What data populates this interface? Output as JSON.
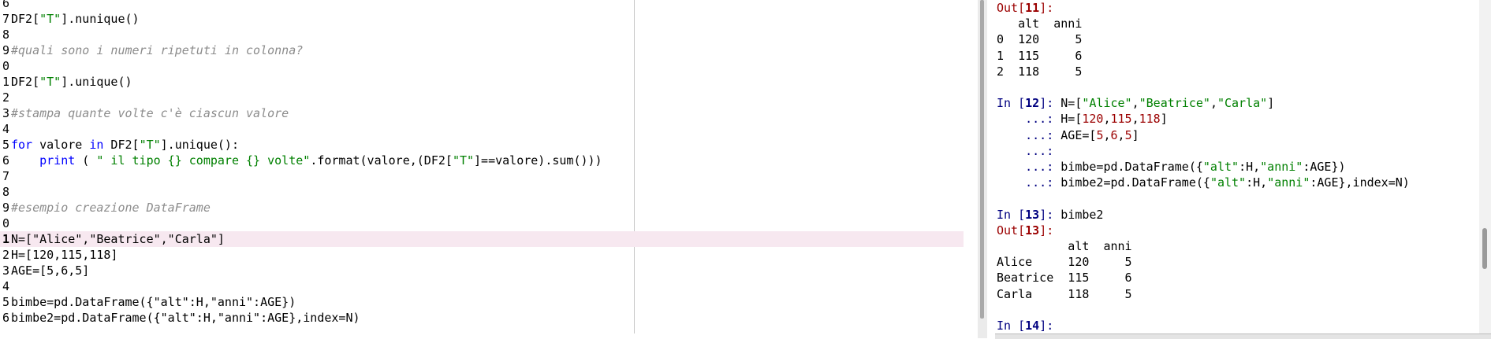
{
  "editor": {
    "lines": [
      {
        "ln": "6",
        "parts": []
      },
      {
        "ln": "7",
        "parts": [
          {
            "t": "DF2["
          },
          {
            "t": "\"T\"",
            "c": "str"
          },
          {
            "t": "].nunique()"
          }
        ]
      },
      {
        "ln": "8",
        "parts": []
      },
      {
        "ln": "9",
        "parts": [
          {
            "t": "#quali sono i numeri ripetuti in colonna?",
            "c": "cmt"
          }
        ]
      },
      {
        "ln": "0",
        "parts": []
      },
      {
        "ln": "1",
        "parts": [
          {
            "t": "DF2["
          },
          {
            "t": "\"T\"",
            "c": "str"
          },
          {
            "t": "].unique()"
          }
        ]
      },
      {
        "ln": "2",
        "parts": []
      },
      {
        "ln": "3",
        "parts": [
          {
            "t": "#stampa quante volte c'è ciascun valore",
            "c": "cmt"
          }
        ]
      },
      {
        "ln": "4",
        "parts": []
      },
      {
        "ln": "5",
        "parts": [
          {
            "t": "for",
            "c": "kw"
          },
          {
            "t": " valore "
          },
          {
            "t": "in",
            "c": "kw"
          },
          {
            "t": " DF2["
          },
          {
            "t": "\"T\"",
            "c": "str"
          },
          {
            "t": "].unique():"
          }
        ]
      },
      {
        "ln": "6",
        "parts": [
          {
            "t": "    "
          },
          {
            "t": "print",
            "c": "fn"
          },
          {
            "t": " ( "
          },
          {
            "t": "\" il tipo {} compare {} volte\"",
            "c": "str"
          },
          {
            "t": ".format(valore,(DF2["
          },
          {
            "t": "\"T\"",
            "c": "str"
          },
          {
            "t": "]==valore).sum()))"
          }
        ]
      },
      {
        "ln": "7",
        "parts": []
      },
      {
        "ln": "8",
        "parts": []
      },
      {
        "ln": "9",
        "parts": [
          {
            "t": "#esempio creazione DataFrame",
            "c": "cmt"
          }
        ]
      },
      {
        "ln": "0",
        "parts": []
      },
      {
        "ln": "1",
        "current": true,
        "parts": [
          {
            "t": "N=[\"Alice\",\"Beatrice\",\"Carla\"]"
          }
        ]
      },
      {
        "ln": "2",
        "parts": [
          {
            "t": "H=[120,115,118]"
          }
        ]
      },
      {
        "ln": "3",
        "parts": [
          {
            "t": "AGE=[5,6,5]"
          }
        ]
      },
      {
        "ln": "4",
        "parts": []
      },
      {
        "ln": "5",
        "parts": [
          {
            "t": "bimbe=pd.DataFrame({\"alt\":H,\"anni\":AGE})"
          }
        ]
      },
      {
        "ln": "6",
        "parts": [
          {
            "t": "bimbe2=pd.DataFrame({\"alt\":H,\"anni\":AGE},index=N)"
          }
        ]
      }
    ]
  },
  "console": {
    "lines": [
      {
        "parts": [
          {
            "t": "Out[",
            "c": "out"
          },
          {
            "t": "11",
            "c": "out num"
          },
          {
            "t": "]:",
            "c": "out"
          }
        ]
      },
      {
        "parts": [
          {
            "t": "   alt  anni"
          }
        ]
      },
      {
        "parts": [
          {
            "t": "0  120     5"
          }
        ]
      },
      {
        "parts": [
          {
            "t": "1  115     6"
          }
        ]
      },
      {
        "parts": [
          {
            "t": "2  118     5"
          }
        ]
      },
      {
        "parts": []
      },
      {
        "parts": [
          {
            "t": "In [",
            "c": "in"
          },
          {
            "t": "12",
            "c": "in num"
          },
          {
            "t": "]: ",
            "c": "in"
          },
          {
            "t": "N=["
          },
          {
            "t": "\"Alice\"",
            "c": "str"
          },
          {
            "t": ","
          },
          {
            "t": "\"Beatrice\"",
            "c": "str"
          },
          {
            "t": ","
          },
          {
            "t": "\"Carla\"",
            "c": "str"
          },
          {
            "t": "]"
          }
        ]
      },
      {
        "parts": [
          {
            "t": "    ...: ",
            "c": "cnt"
          },
          {
            "t": "H=["
          },
          {
            "t": "120",
            "c": "dnum"
          },
          {
            "t": ","
          },
          {
            "t": "115",
            "c": "dnum"
          },
          {
            "t": ","
          },
          {
            "t": "118",
            "c": "dnum"
          },
          {
            "t": "]"
          }
        ]
      },
      {
        "parts": [
          {
            "t": "    ...: ",
            "c": "cnt"
          },
          {
            "t": "AGE=["
          },
          {
            "t": "5",
            "c": "dnum"
          },
          {
            "t": ","
          },
          {
            "t": "6",
            "c": "dnum"
          },
          {
            "t": ","
          },
          {
            "t": "5",
            "c": "dnum"
          },
          {
            "t": "]"
          }
        ]
      },
      {
        "parts": [
          {
            "t": "    ...:",
            "c": "cnt"
          }
        ]
      },
      {
        "parts": [
          {
            "t": "    ...: ",
            "c": "cnt"
          },
          {
            "t": "bimbe=pd.DataFrame({"
          },
          {
            "t": "\"alt\"",
            "c": "str"
          },
          {
            "t": ":H,"
          },
          {
            "t": "\"anni\"",
            "c": "str"
          },
          {
            "t": ":AGE})"
          }
        ]
      },
      {
        "parts": [
          {
            "t": "    ...: ",
            "c": "cnt"
          },
          {
            "t": "bimbe2=pd.DataFrame({"
          },
          {
            "t": "\"alt\"",
            "c": "str"
          },
          {
            "t": ":H,"
          },
          {
            "t": "\"anni\"",
            "c": "str"
          },
          {
            "t": ":AGE},index=N)"
          }
        ]
      },
      {
        "parts": []
      },
      {
        "parts": [
          {
            "t": "In [",
            "c": "in"
          },
          {
            "t": "13",
            "c": "in num"
          },
          {
            "t": "]: ",
            "c": "in"
          },
          {
            "t": "bimbe2"
          }
        ]
      },
      {
        "parts": [
          {
            "t": "Out[",
            "c": "out"
          },
          {
            "t": "13",
            "c": "out num"
          },
          {
            "t": "]:",
            "c": "out"
          }
        ]
      },
      {
        "parts": [
          {
            "t": "          alt  anni"
          }
        ]
      },
      {
        "parts": [
          {
            "t": "Alice     120     5"
          }
        ]
      },
      {
        "parts": [
          {
            "t": "Beatrice  115     6"
          }
        ]
      },
      {
        "parts": [
          {
            "t": "Carla     118     5"
          }
        ]
      },
      {
        "parts": []
      },
      {
        "parts": [
          {
            "t": "In [",
            "c": "in"
          },
          {
            "t": "14",
            "c": "in num"
          },
          {
            "t": "]:",
            "c": "in"
          }
        ]
      }
    ]
  }
}
